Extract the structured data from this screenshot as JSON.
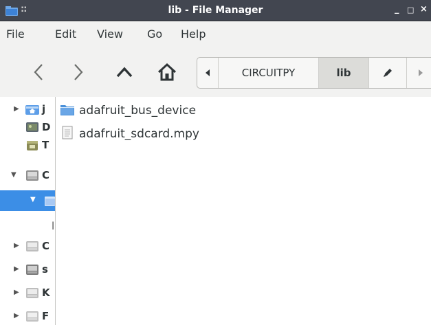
{
  "window": {
    "title": "lib - File Manager",
    "grip": "::",
    "min_glyph": "_",
    "max_glyph": "□",
    "close_glyph": "×"
  },
  "menu": {
    "items": [
      "File",
      "Edit",
      "View",
      "Go",
      "Help"
    ]
  },
  "toolbar": {
    "back_glyph": "❮",
    "forward_glyph": "❯",
    "up_glyph": "^",
    "path_segments": [
      "CIRCUITPY",
      "lib"
    ],
    "active_segment": "lib"
  },
  "sidebar": {
    "items": [
      {
        "label": "j",
        "icon": "folder-home-icon",
        "expander": "collapsed"
      },
      {
        "label": "D",
        "icon": "desktop-icon",
        "expander": "none"
      },
      {
        "label": "T",
        "icon": "trash-icon",
        "expander": "none"
      },
      {
        "label": "C",
        "icon": "drive-icon",
        "expander": "expanded"
      },
      {
        "label": "",
        "icon": "folder-icon",
        "expander": "expanded",
        "selected": true
      },
      {
        "label": "l",
        "icon": "",
        "expander": "none"
      },
      {
        "label": "C",
        "icon": "drive-icon",
        "expander": "collapsed"
      },
      {
        "label": "s",
        "icon": "drive-icon",
        "expander": "collapsed"
      },
      {
        "label": "K",
        "icon": "drive-icon",
        "expander": "collapsed"
      },
      {
        "label": "F",
        "icon": "drive-icon",
        "expander": "collapsed"
      }
    ]
  },
  "files": [
    {
      "name": "adafruit_bus_device",
      "icon": "folder-icon"
    },
    {
      "name": "adafruit_sdcard.mpy",
      "icon": "document-icon"
    }
  ],
  "colors": {
    "titlebar": "#424650",
    "selection": "#3c8ee6",
    "folder": "#4a90d9"
  }
}
